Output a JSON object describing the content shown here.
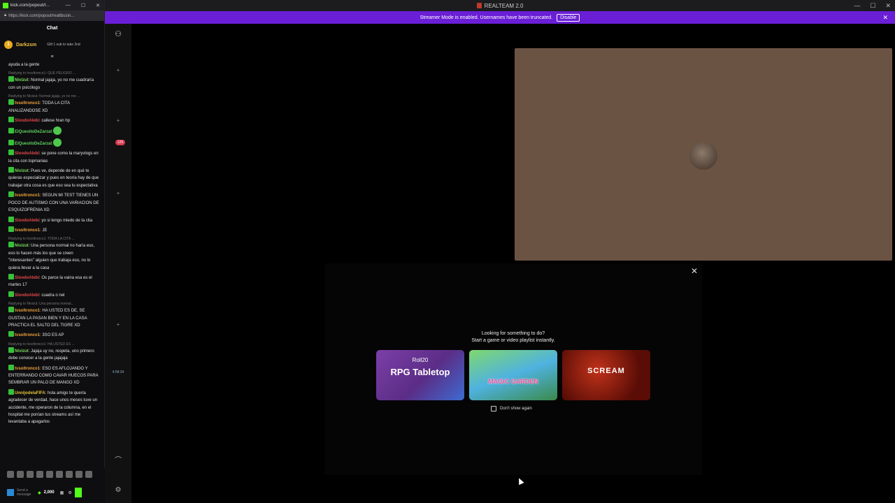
{
  "window": {
    "title": "REALTEAM 2.0",
    "controls": {
      "minimize": "—",
      "maximize": "☐",
      "close": "✕"
    }
  },
  "banner": {
    "text": "Streamer Mode is enabled. Usernames have been truncated.",
    "disable_label": "Disable"
  },
  "rail": {
    "badge": "129",
    "time": "4:58:34"
  },
  "chat_window": {
    "title": "kick.com/popout/r...",
    "url": "https://kick.com/popout/realtbusin...",
    "header": "Chat",
    "pinned": {
      "rank": "1",
      "name": "Darkzsm",
      "sub_text": "Gift 1 sub to take 2nd"
    }
  },
  "messages": [
    {
      "reply": "",
      "user": "",
      "text": "ayuda a la gente",
      "color": "#e4e4e4"
    },
    {
      "reply": "Replying to tvsoltronco1: QUE PELIGRO ...",
      "user": "Nivizut",
      "text": ": Normal jajaja, yo no me cuadraría con un psicólogo",
      "color": "#7bdc5a"
    },
    {
      "reply": "Replying to Nivizut: Normal jajaja, yo no me ...",
      "user": "tvsoltronco1",
      "text": ": TODA LA CITA ANALIZANDOSE XD",
      "color": "#f0a23a"
    },
    {
      "reply": "",
      "user": "SloodoAlebi",
      "text": ": callese hran hp",
      "color": "#e54848"
    },
    {
      "reply": "",
      "user": "ElQuesitoDeZarzal",
      "text": ":",
      "color": "#5fd35f"
    },
    {
      "reply": "",
      "user": "ElQuesitoDeZarzal",
      "text": ":",
      "color": "#5fd35f"
    },
    {
      "reply": "",
      "user": "SloodoAlebi",
      "text": ": se pone como la maryvlogs en la cita con topmanias",
      "color": "#e54848"
    },
    {
      "reply": "",
      "user": "Nivizut",
      "text": ": Pues ve, depende de en qué te quieras especializar y pues en teoría hay de que trabajar otra cosa es que eso sea tu espectativa",
      "color": "#7bdc5a"
    },
    {
      "reply": "",
      "user": "tvsoltronco1",
      "text": ": SEGUN MI TEST TIENES UN POCO DE AUTISMO CON UNA VARIACION DE ESQUIZOFRENIA XD",
      "color": "#f0a23a"
    },
    {
      "reply": "",
      "user": "SloodoAlebi",
      "text": ": yo si tengo miedo de la cita",
      "color": "#e54848"
    },
    {
      "reply": "",
      "user": "tvsoltronco1",
      "text": ": JE",
      "color": "#f0a23a"
    },
    {
      "reply": "Replying to tvsoltronco1: TODA LA CITA ...",
      "user": "Nivizut",
      "text": ": Una persona normal no haría eso, eso lo hacen más los que se creen \"interesantes\" alguien que trabaja eso, no lo quiera llevar a la casa",
      "color": "#7bdc5a"
    },
    {
      "reply": "",
      "user": "SloodoAlebi",
      "text": ": Os parce la vaina esa es el martes 17",
      "color": "#e54848"
    },
    {
      "reply": "",
      "user": "SloodoAlebi",
      "text": ": cuadra o nel",
      "color": "#e54848"
    },
    {
      "reply": "Replying to Nivizut: Una persona normal...",
      "user": "tvsoltronco1",
      "text": ": HA USTED ES DE, SE GUSTAN LA PASAN BIEN Y EN LA CASA PRACTICA EL SALTO DEL TIGRE XD",
      "color": "#f0a23a"
    },
    {
      "reply": "",
      "user": "tvsoltronco1",
      "text": ": 3SO ES AP",
      "color": "#f0a23a"
    },
    {
      "reply": "Replying to tvsoltronco1: HA USTED ES ...",
      "user": "Nivizut",
      "text": ": Jajaja uy no, respeta, uno primero debe conocer a la gente jajajaja",
      "color": "#7bdc5a"
    },
    {
      "reply": "",
      "user": "tvsoltronco1",
      "text": ": ESO ES AFLOJANDO Y ENTERRANDO COMO CAVAR HUECOS PARA SEMBRAR UN PALO DE MANGO XD",
      "color": "#f0a23a"
    },
    {
      "reply": "",
      "user": "UnnijodelaFIFA",
      "text": ": hola amigo te quería agradecer de verdad, hace unos meses tuve un accidente, me operaron de la columna, en el hospital me ponían tus streams así me levantaba a apagarlos",
      "color": "#e2c33a"
    }
  ],
  "chat_input": {
    "placeholder": "Send a message",
    "points": "2,000"
  },
  "modal": {
    "close_label": "✕",
    "prompt_line1": "Looking for something to do?",
    "prompt_line2": "Start a game or video playlist instantly.",
    "cards": [
      {
        "brand": "Roll20",
        "label": "RPG Tabletop"
      },
      {
        "label": "MAGIC GARDEN"
      },
      {
        "label": "SCREAM"
      }
    ],
    "dont_show_label": "Don't show again"
  },
  "colors": {
    "banner": "#6a1fd6",
    "kick_green": "#53fc18",
    "video_bg": "#6b5343"
  }
}
